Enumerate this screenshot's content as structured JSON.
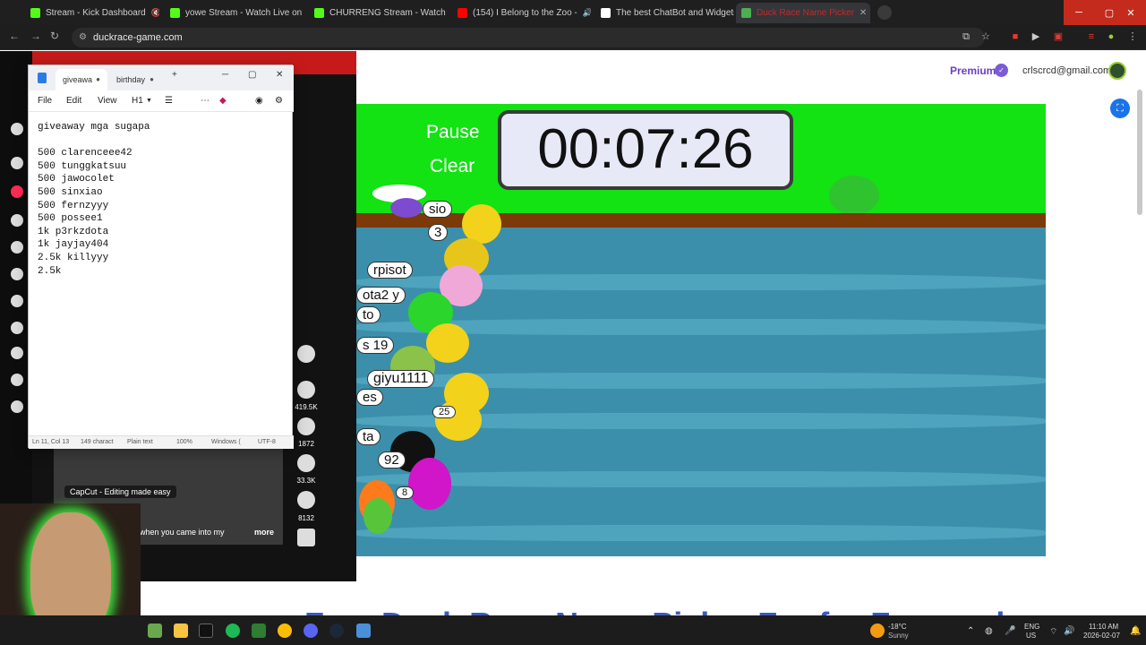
{
  "browser": {
    "tabs": [
      {
        "label": "Stream - Kick Dashboard",
        "color": "#53fc18",
        "audio": true
      },
      {
        "label": "yowe Stream - Watch Live on Kick",
        "color": "#53fc18",
        "audio": true
      },
      {
        "label": "CHURRENG Stream - Watch Live",
        "color": "#53fc18",
        "audio": false
      },
      {
        "label": "(154) I Belong to the Zoo -",
        "color": "#ff0000",
        "audio": true
      },
      {
        "label": "The best ChatBot and Widgets",
        "color": "#ffffff",
        "audio": false
      },
      {
        "label": "Duck Race Name Picker",
        "color": "#4caf50",
        "audio": false,
        "active": true
      }
    ],
    "url": "duckrace-game.com"
  },
  "site": {
    "premium_label": "Premium",
    "email": "crlscrcd@gmail.com",
    "below_title": "Free Duck Race Name Picker For for Free and"
  },
  "game": {
    "pause_label": "Pause",
    "clear_label": "Clear",
    "timer": "00:07:26",
    "labels": [
      {
        "text": "sio"
      },
      {
        "text": "3"
      },
      {
        "text": "rpisot"
      },
      {
        "text": "ota2 y"
      },
      {
        "text": "to"
      },
      {
        "text": "s 19"
      },
      {
        "text": "giyu1111"
      },
      {
        "text": "es"
      },
      {
        "text": "25"
      },
      {
        "text": "ta"
      },
      {
        "text": "92"
      },
      {
        "text": "8"
      }
    ]
  },
  "tiktok": {
    "likes": "419.5K",
    "comments": "1872",
    "saves": "33.3K",
    "shares": "8132",
    "capcut": "CapCut - Editing made easy",
    "caption": "when you came into my",
    "more": "more"
  },
  "notepad": {
    "tabs": [
      "giveawa",
      "birthday"
    ],
    "menu": [
      "File",
      "Edit",
      "View",
      "H1"
    ],
    "content": "giveaway mga sugapa\n\n500 clarenceee42\n500 tunggkatsuu\n500 jawocolet\n500 sinxiao\n500 fernzyyy\n500 possee1\n1k p3rkzdota\n1k jayjay404\n2.5k killyyy\n2.5k",
    "status": {
      "position": "Ln 11, Col 13",
      "chars": "149 charact",
      "format": "Plain text",
      "zoom": "100%",
      "eol": "Windows (",
      "encoding": "UTF-8"
    }
  },
  "taskbar": {
    "weather_temp": "-18°C",
    "weather_desc": "Sunny",
    "lang": "ENG",
    "region": "US",
    "time": "11:10 AM",
    "date": "2026-02-07"
  },
  "colors": {
    "grass": "#13e213",
    "water": "#3c8faa",
    "bank": "#7b3a07",
    "accent": "#6c3fc5"
  }
}
